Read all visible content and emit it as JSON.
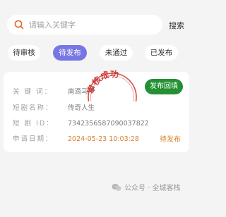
{
  "search": {
    "placeholder": "请输入关键字",
    "button_label": "搜索"
  },
  "tabs": [
    {
      "label": "待审核",
      "active": false
    },
    {
      "label": "待发布",
      "active": true
    },
    {
      "label": "未通过",
      "active": false
    },
    {
      "label": "已发布",
      "active": false
    }
  ],
  "card": {
    "rows": [
      {
        "label": "关 键 词：",
        "value": "南滴马甲"
      },
      {
        "label": "短剧名称：",
        "value": "传奇人生"
      },
      {
        "label": "短 剧 ID：",
        "value": "7342356587090037822"
      },
      {
        "label": "申请日期：",
        "value": "2024-05-23 10:03:28"
      }
    ],
    "action_label": "发布回填",
    "status": "待发布",
    "stamp_text": "审核成功"
  },
  "watermark": {
    "text": "公众号 · 全城客栈"
  },
  "colors": {
    "accent": "#7776e4",
    "action_green": "#249034",
    "date_orange": "#d98230",
    "stamp_red": "#c9302c"
  }
}
